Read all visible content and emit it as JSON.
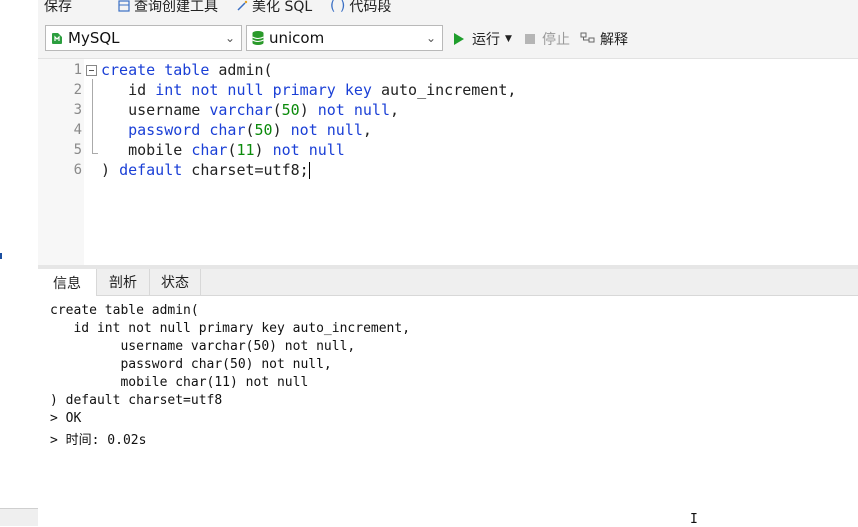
{
  "toolbar_top": {
    "save": "保存",
    "query_builder": "查询创建工具",
    "beautify": "美化 SQL",
    "snippet": "代码段"
  },
  "toolbar": {
    "connection": "MySQL",
    "database": "unicom",
    "run": "运行",
    "stop": "停止",
    "explain": "解释"
  },
  "editor": {
    "line_numbers": [
      "1",
      "2",
      "3",
      "4",
      "5",
      "6"
    ]
  },
  "tabs": [
    "信息",
    "剖析",
    "状态"
  ],
  "output": [
    "create table admin(",
    "   id int not null primary key auto_increment,",
    "         username varchar(50) not null,",
    "         password char(50) not null,",
    "         mobile char(11) not null",
    ") default charset=utf8",
    "> OK",
    "> 时间: 0.02s"
  ],
  "colors": {
    "keyword": "#1a3fd6",
    "number": "#0a8a0a",
    "run_icon": "#1f9e2c",
    "db_icon": "#2a9a2a"
  }
}
